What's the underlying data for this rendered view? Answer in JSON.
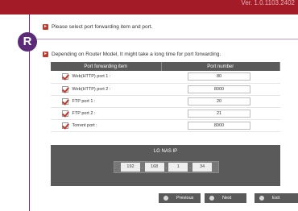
{
  "header": {
    "version_text": "Ver. 1.0.1103.2402"
  },
  "step": {
    "badge": "R"
  },
  "instructions": {
    "line1": "Please select port forwarding item and port.",
    "line2": "Depending on Router Model, It might take a long time for port forwarding."
  },
  "table": {
    "col_item": "Port forwarding item",
    "col_port": "Port number",
    "rows": [
      {
        "label": "Web(HTTP) port 1 :",
        "port": "80",
        "checked": true
      },
      {
        "label": "Web(HTTP) port 2 :",
        "port": "8000",
        "checked": true
      },
      {
        "label": "FTP port 1 :",
        "port": "20",
        "checked": true
      },
      {
        "label": "FTP port 2 :",
        "port": "21",
        "checked": true
      },
      {
        "label": "Torrent port :",
        "port": "8000",
        "checked": true
      }
    ]
  },
  "nas": {
    "title": "LG NAS IP",
    "ip": [
      "192",
      "168",
      "1",
      "34"
    ]
  },
  "buttons": {
    "previous": "Previous",
    "next": "Next",
    "exit": "Exit"
  },
  "colors": {
    "topbar": "#a31b27",
    "accent": "#5b2b78",
    "check": "#c0392b",
    "panel": "#5a5a5a"
  }
}
